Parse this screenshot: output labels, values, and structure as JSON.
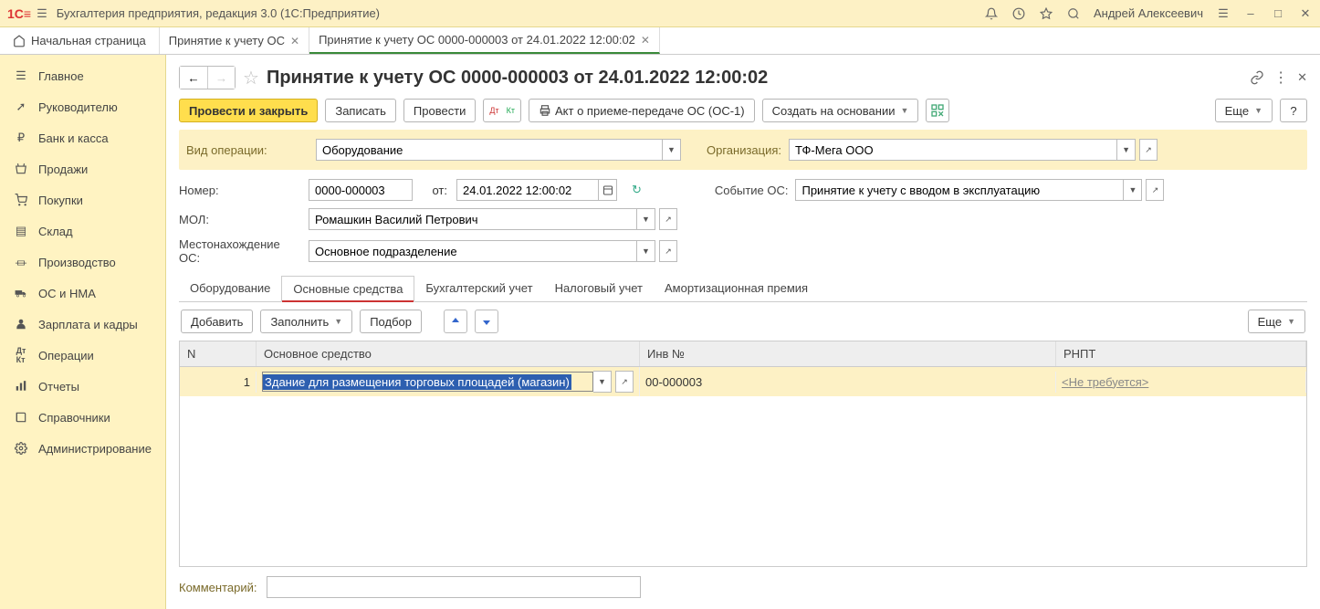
{
  "titlebar": {
    "app_name": "Бухгалтерия предприятия, редакция 3.0  (1С:Предприятие)",
    "user": "Андрей Алексеевич"
  },
  "tabs": {
    "home": "Начальная страница",
    "t1": "Принятие к учету ОС",
    "t2": "Принятие к учету ОС 0000-000003 от 24.01.2022 12:00:02"
  },
  "sidebar": {
    "items": [
      "Главное",
      "Руководителю",
      "Банк и касса",
      "Продажи",
      "Покупки",
      "Склад",
      "Производство",
      "ОС и НМА",
      "Зарплата и кадры",
      "Операции",
      "Отчеты",
      "Справочники",
      "Администрирование"
    ]
  },
  "doc": {
    "title": "Принятие к учету ОС 0000-000003 от 24.01.2022 12:00:02"
  },
  "toolbar": {
    "commit_close": "Провести и закрыть",
    "save": "Записать",
    "commit": "Провести",
    "act": "Акт о приеме-передаче ОС (ОС-1)",
    "create_based": "Создать на основании",
    "more": "Еще"
  },
  "form": {
    "op_type_label": "Вид операции:",
    "op_type_value": "Оборудование",
    "org_label": "Организация:",
    "org_value": "ТФ-Мега ООО",
    "number_label": "Номер:",
    "number_value": "0000-000003",
    "from_label": "от:",
    "date_value": "24.01.2022 12:00:02",
    "event_label": "Событие ОС:",
    "event_value": "Принятие к учету с вводом в эксплуатацию",
    "mol_label": "МОЛ:",
    "mol_value": "Ромашкин Василий Петрович",
    "loc_label": "Местонахождение ОС:",
    "loc_value": "Основное подразделение"
  },
  "detail_tabs": [
    "Оборудование",
    "Основные средства",
    "Бухгалтерский учет",
    "Налоговый учет",
    "Амортизационная премия"
  ],
  "detail_toolbar": {
    "add": "Добавить",
    "fill": "Заполнить",
    "pick": "Подбор",
    "more": "Еще"
  },
  "grid": {
    "headers": {
      "n": "N",
      "os": "Основное средство",
      "inv": "Инв №",
      "rnpt": "РНПТ"
    },
    "rows": [
      {
        "n": "1",
        "asset": "Здание для размещения торговых площадей (магазин)",
        "inv": "00-000003",
        "rnpt": "<Не требуется>"
      }
    ]
  },
  "comment_label": "Комментарий:"
}
